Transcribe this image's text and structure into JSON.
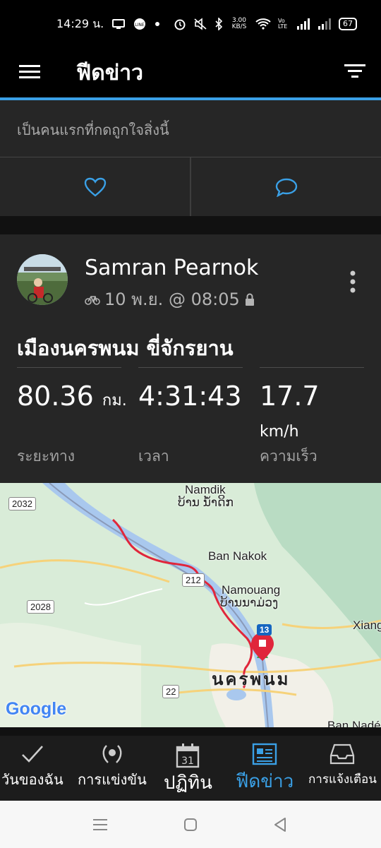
{
  "status_bar": {
    "time": "14:29 น.",
    "network_speed": "3.00 KB/S",
    "volte": "Vo LTE",
    "battery": "67"
  },
  "app_bar": {
    "title": "ฟีดข่าว"
  },
  "likes": {
    "text": "เป็นคนแรกที่กดถูกใจสิ่งนี้"
  },
  "activity": {
    "user_name": "Samran Pearnok",
    "date_time": "10 พ.ย. @ 08:05",
    "title": "เมืองนครพนม ขี่จักรยาน",
    "stats": [
      {
        "value": "80.36",
        "unit": "กม.",
        "label": "ระยะทาง"
      },
      {
        "value": "4:31:43",
        "unit": "",
        "label": "เวลา"
      },
      {
        "value": "17.7",
        "unit": "km/h",
        "label": "ความเร็ว"
      }
    ]
  },
  "map": {
    "labels": {
      "namdik": "Namdik",
      "namdik_lao": "ບ້ານ ນ້ຳດິກ",
      "ban_nakok": "Ban Nakok",
      "namouang": "Namouang",
      "namouang_lao": "ບ້ານນາມ່ວງ",
      "nakhon_phanom": "นครพนม",
      "xiang": "Xiang",
      "ban_nade": "Ban Nadé"
    },
    "routes": {
      "r2032": "2032",
      "r2028": "2028",
      "r212": "212",
      "r22": "22",
      "r13": "13"
    },
    "google": "Google"
  },
  "bottom_nav": {
    "items": [
      {
        "label": "วันของฉัน",
        "icon": "check-icon"
      },
      {
        "label": "การแข่งขัน",
        "icon": "laurel-icon"
      },
      {
        "label": "ปฏิทิน",
        "icon": "calendar-icon",
        "day": "31"
      },
      {
        "label": "ฟีดข่าว",
        "icon": "newsfeed-icon",
        "active": true
      },
      {
        "label": "การแจ้งเตือน",
        "icon": "inbox-icon"
      }
    ]
  },
  "colors": {
    "accent": "#3aa0e6",
    "card": "#262626",
    "route": "#e0263b"
  }
}
